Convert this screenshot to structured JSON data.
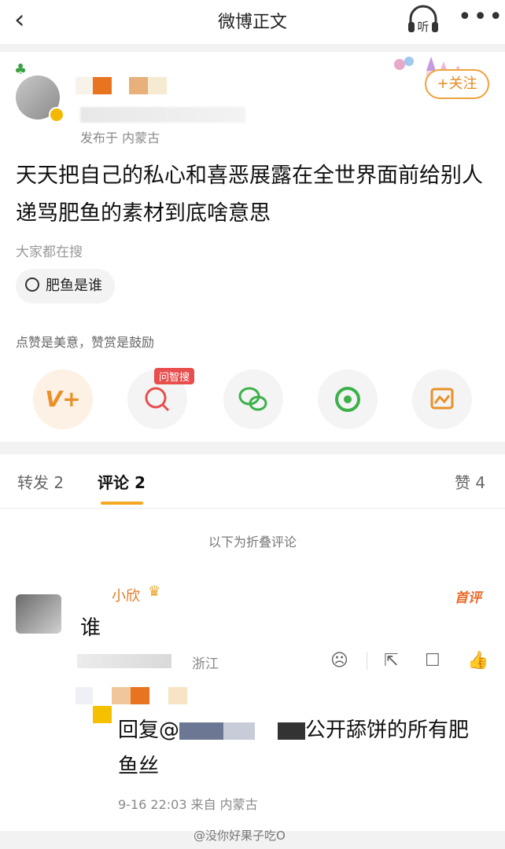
{
  "nav": {
    "title": "微博正文",
    "back_icon": "chevron-left-icon",
    "listen_label": "听",
    "more_label": "•••"
  },
  "post": {
    "follow_label": "+关注",
    "location": "发布于 内蒙古",
    "text": "天天把自己的私心和喜恶展露在全世界面前给别人递骂肥鱼的素材到底啥意思",
    "hot_search_label": "大家都在搜",
    "hot_search_query": "肥鱼是谁",
    "tip": "点赞是美意，赞赏是鼓励",
    "ai_search_badge": "问智搜",
    "colors": {
      "accent": "#f5a623",
      "follow": "#e58a1f"
    }
  },
  "actions": [
    {
      "icon": "appreciate-v-icon",
      "glyph": "V+",
      "color": "#e8912a"
    },
    {
      "icon": "ai-search-icon",
      "glyph": "Q",
      "color": "#e84e4e"
    },
    {
      "icon": "wechat-icon",
      "glyph": "◎",
      "color": "#3cb14a"
    },
    {
      "icon": "moments-icon",
      "glyph": "✿",
      "color": "#3cb14a"
    },
    {
      "icon": "save-image-icon",
      "glyph": "▣",
      "color": "#e8912a"
    }
  ],
  "tabs": {
    "repost": "转发 2",
    "comment": "评论 2",
    "like": "赞 4"
  },
  "comments": {
    "folded_notice": "以下为折叠评论",
    "first": {
      "username": "小欣",
      "badge": "首评",
      "text": "谁",
      "location": "浙江"
    },
    "reply": {
      "prefix": "回复@",
      "text": "公开舔饼的所有肥鱼丝",
      "meta": "9-16 22:03 来自 内蒙古"
    }
  },
  "watermark": "@没你好果子吃O"
}
